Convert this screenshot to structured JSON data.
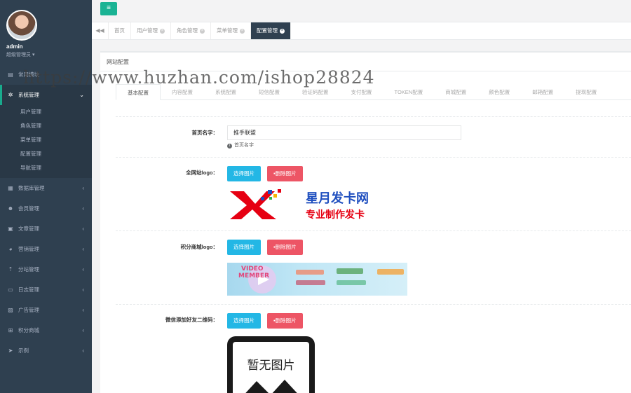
{
  "sidebar": {
    "username": "admin",
    "role": "超级管理员",
    "items": [
      {
        "label": "常用模块",
        "icon": "home-icon"
      },
      {
        "label": "系统管理",
        "icon": "gear-icon"
      },
      {
        "label": "数据库管理",
        "icon": "database-icon"
      },
      {
        "label": "会员管理",
        "icon": "users-icon"
      },
      {
        "label": "文章管理",
        "icon": "file-icon"
      },
      {
        "label": "营销管理",
        "icon": "chart-icon"
      },
      {
        "label": "分站管理",
        "icon": "sitemap-icon"
      },
      {
        "label": "日志管理",
        "icon": "log-icon"
      },
      {
        "label": "广告管理",
        "icon": "image-icon"
      },
      {
        "label": "积分商城",
        "icon": "cart-icon"
      },
      {
        "label": "示例",
        "icon": "send-icon"
      }
    ],
    "submenu": [
      "用户管理",
      "角色管理",
      "菜单管理",
      "配置管理",
      "导航管理"
    ]
  },
  "tabs": [
    "首页",
    "用户管理",
    "角色管理",
    "菜单管理",
    "配置管理"
  ],
  "panel": {
    "title": "网站配置",
    "config_tabs": [
      "基本配置",
      "内容配置",
      "系统配置",
      "短信配置",
      "验证码配置",
      "支付配置",
      "TOKEN配置",
      "商城配置",
      "颜色配置",
      "邮箱配置",
      "提现配置"
    ],
    "fields": {
      "home_name_label": "首页名字：",
      "home_name_value": "推手联盟",
      "home_name_help": "首页名字",
      "site_logo_label": "全网站logo：",
      "points_logo_label": "积分商城logo：",
      "wechat_qr_label": "微信添加好友二维码："
    },
    "buttons": {
      "select": "选择图片",
      "delete": "删除图片"
    },
    "logo1": {
      "title": "星月发卡网",
      "subtitle": "专业制作发卡",
      "mark": "X"
    },
    "logo2": {
      "line1": "VIDEO",
      "line2": "MEMBER"
    },
    "qr_placeholder": "暂无图片"
  },
  "watermark": "https://www.huzhan.com/ishop28824"
}
